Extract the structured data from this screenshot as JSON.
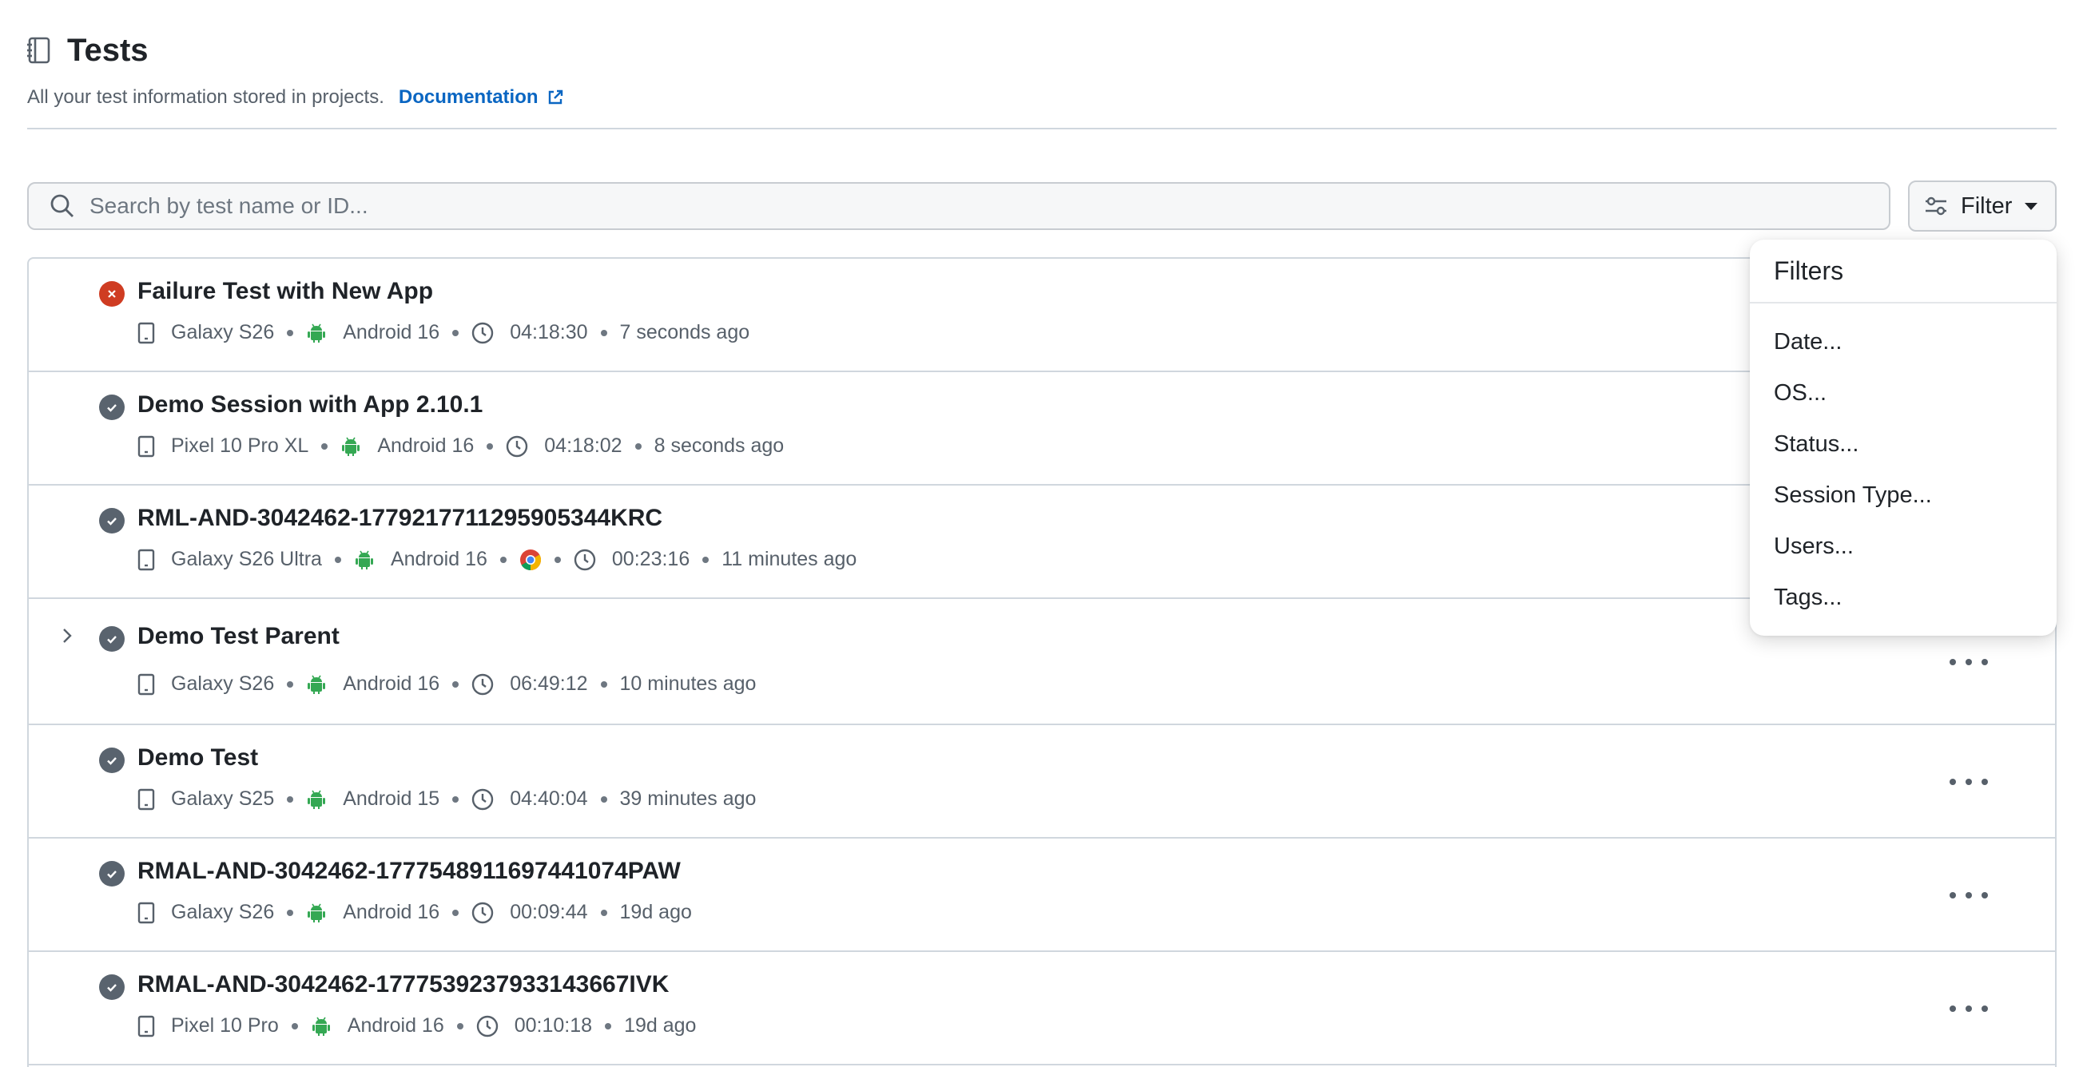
{
  "header": {
    "title": "Tests",
    "subtitle": "All your test information stored in projects.",
    "doc_link": "Documentation"
  },
  "search": {
    "placeholder": "Search by test name or ID..."
  },
  "filter_button": {
    "label": "Filter"
  },
  "filters_menu": {
    "title": "Filters",
    "options": [
      "Date...",
      "OS...",
      "Status...",
      "Session Type...",
      "Users...",
      "Tags..."
    ]
  },
  "colors": {
    "fail": "#cf3c22",
    "pass": "#59636e",
    "android": "#3ddc84",
    "link": "#0a66c2"
  },
  "tests": [
    {
      "name": "Failure Test with New App",
      "status": "failed",
      "device": "Galaxy S26",
      "os": "Android 16",
      "duration": "04:18:30",
      "time": "7 seconds ago"
    },
    {
      "name": "Demo Session with App 2.10.1",
      "status": "passed",
      "device": "Pixel 10 Pro XL",
      "os": "Android 16",
      "duration": "04:18:02",
      "time": "8 seconds ago"
    },
    {
      "name": "RML-AND-3042462-1779217711295905344KRC",
      "status": "passed",
      "device": "Galaxy S26 Ultra",
      "os": "Android 16",
      "browser_icon": "chrome-icon",
      "duration": "00:23:16",
      "time": "11 minutes ago"
    },
    {
      "name": "Demo Test Parent",
      "status": "passed",
      "expandable": true,
      "device": "Galaxy S26",
      "os": "Android 16",
      "duration": "06:49:12",
      "time": "10 minutes ago"
    },
    {
      "name": "Demo Test",
      "status": "passed",
      "device": "Galaxy S25",
      "os": "Android 15",
      "duration": "04:40:04",
      "time": "39 minutes ago"
    },
    {
      "name": "RMAL-AND-3042462-1777548911697441074PAW",
      "status": "passed",
      "device": "Galaxy S26",
      "os": "Android 16",
      "duration": "00:09:44",
      "time": "19d ago"
    },
    {
      "name": "RMAL-AND-3042462-1777539237933143667IVK",
      "status": "passed",
      "device": "Pixel 10 Pro",
      "os": "Android 16",
      "duration": "00:10:18",
      "time": "19d ago"
    }
  ]
}
